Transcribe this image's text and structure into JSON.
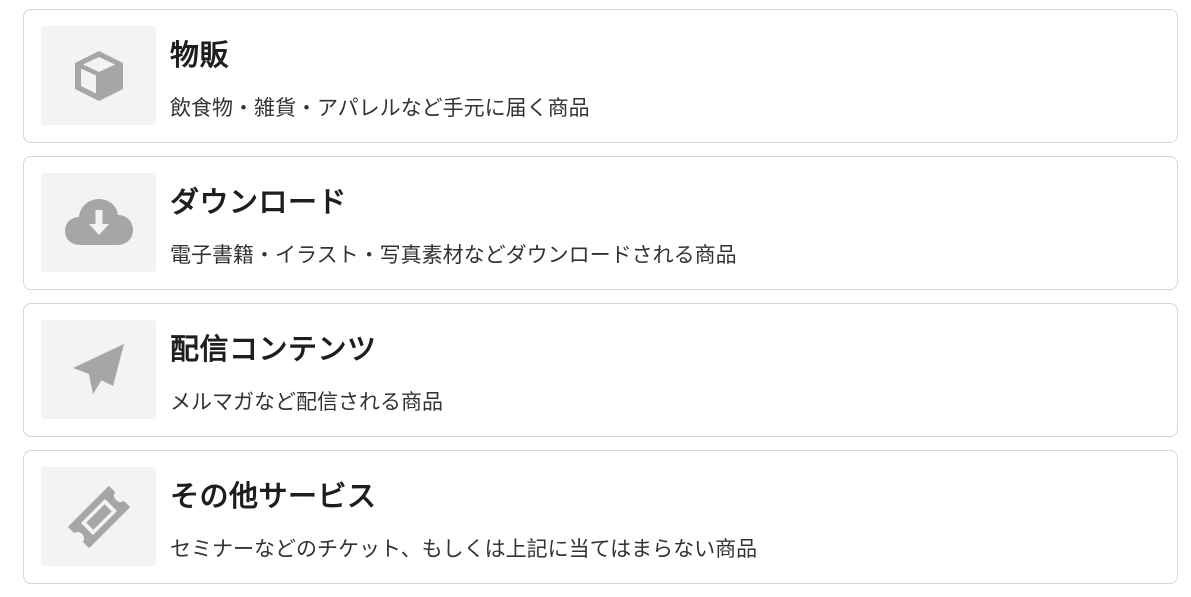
{
  "colors": {
    "icon": "#a6a6a6",
    "thumb_bg": "#f3f3f3",
    "border": "#d6d6d6"
  },
  "items": [
    {
      "icon": "box-icon",
      "title": "物販",
      "description": "飲食物・雑貨・アパレルなど手元に届く商品"
    },
    {
      "icon": "cloud-download-icon",
      "title": "ダウンロード",
      "description": "電子書籍・イラスト・写真素材などダウンロードされる商品"
    },
    {
      "icon": "paper-plane-icon",
      "title": "配信コンテンツ",
      "description": "メルマガなど配信される商品"
    },
    {
      "icon": "ticket-icon",
      "title": "その他サービス",
      "description": "セミナーなどのチケット、もしくは上記に当てはまらない商品"
    }
  ]
}
